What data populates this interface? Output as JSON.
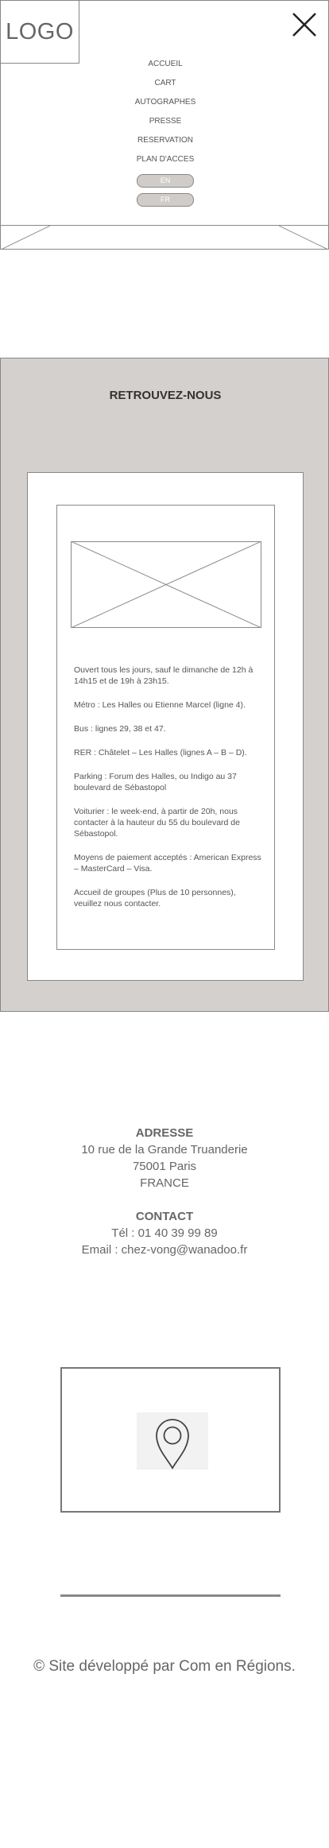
{
  "header": {
    "logo": "LOGO",
    "close_label": "×",
    "nav": [
      "ACCUEIL",
      "CART",
      "AUTOGRAPHES",
      "PRESSE",
      "RESERVATION",
      "PLAN D'ACCES"
    ],
    "lang": [
      "EN",
      "FR"
    ]
  },
  "retrouvez": {
    "title": "RETROUVEZ-NOUS",
    "info": [
      "Ouvert tous les jours, sauf le dimanche de 12h à 14h15 et de 19h à 23h15.",
      "Métro : Les Halles ou Etienne Marcel (ligne 4).",
      "Bus : lignes 29, 38 et 47.",
      "RER : Châtelet – Les Halles (lignes A – B – D).",
      "Parking : Forum des Halles, ou Indigo au 37 boulevard de Sébastopol",
      "Voiturier : le week-end, à partir de 20h, nous contacter à la hauteur du 55 du boulevard de Sébastopol.",
      "Moyens de paiement acceptés : American Express – MasterCard – Visa.",
      "Accueil de groupes (Plus de 10 personnes), veuillez nous contacter."
    ]
  },
  "address": {
    "heading": "ADRESSE",
    "line1": "10 rue de la Grande Truanderie",
    "line2": "75001 Paris",
    "line3": "FRANCE",
    "contact_heading": "CONTACT",
    "phone": "Tél : 01 40 39 99 89",
    "email": "Email : chez-vong@wanadoo.fr"
  },
  "map": {
    "icon": "location-pin-icon"
  },
  "footer": {
    "copyright": "© Site développé par Com en Régions."
  }
}
